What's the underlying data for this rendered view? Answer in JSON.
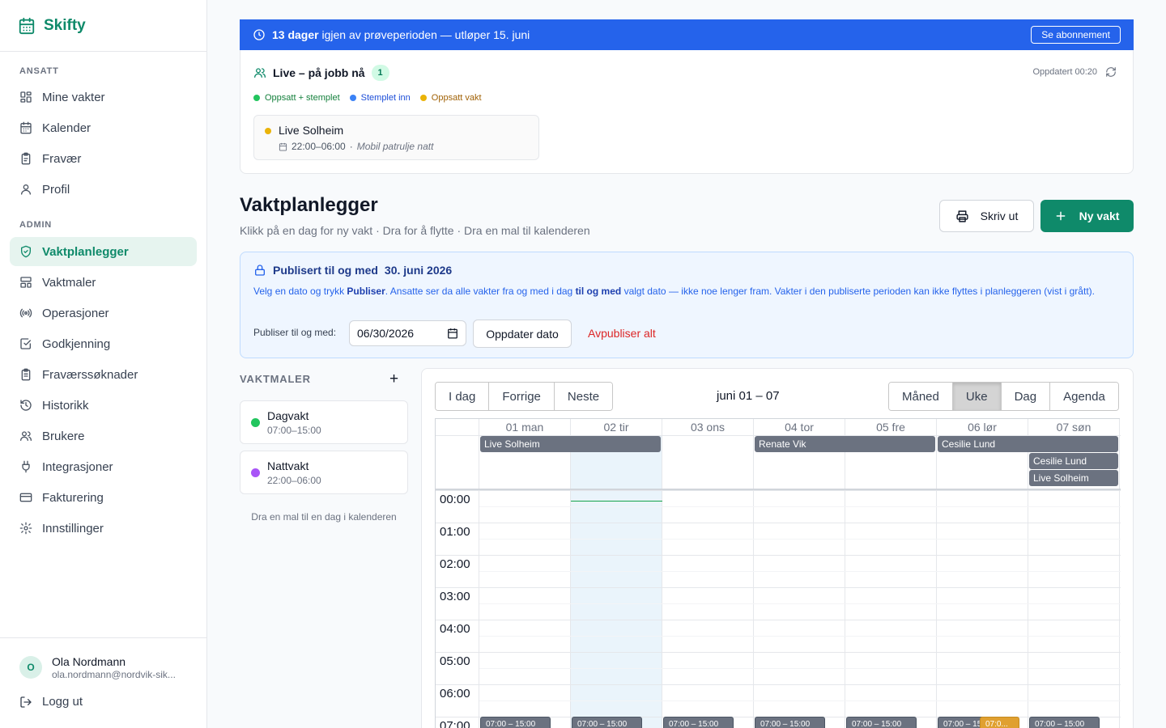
{
  "brand": {
    "name": "Skifty"
  },
  "sidebar": {
    "section_employee": "ANSATT",
    "section_admin": "ADMIN",
    "employee_items": [
      {
        "label": "Mine vakter",
        "icon": "dashboard-icon"
      },
      {
        "label": "Kalender",
        "icon": "calendar-icon"
      },
      {
        "label": "Fravær",
        "icon": "clipboard-icon"
      },
      {
        "label": "Profil",
        "icon": "user-icon"
      }
    ],
    "admin_items": [
      {
        "label": "Vaktplanlegger",
        "icon": "shield-icon",
        "active": true
      },
      {
        "label": "Vaktmaler",
        "icon": "template-icon"
      },
      {
        "label": "Operasjoner",
        "icon": "radio-icon"
      },
      {
        "label": "Godkjenning",
        "icon": "check-square-icon"
      },
      {
        "label": "Fraværssøknader",
        "icon": "clipboard-list-icon"
      },
      {
        "label": "Historikk",
        "icon": "history-icon"
      },
      {
        "label": "Brukere",
        "icon": "users-icon"
      },
      {
        "label": "Integrasjoner",
        "icon": "plug-icon"
      },
      {
        "label": "Fakturering",
        "icon": "credit-card-icon"
      },
      {
        "label": "Innstillinger",
        "icon": "gear-icon"
      }
    ],
    "user": {
      "initial": "O",
      "name": "Ola Nordmann",
      "email": "ola.nordmann@nordvik-sik..."
    },
    "logout": "Logg ut"
  },
  "trial": {
    "days": "13 dager",
    "text": "igjen av prøveperioden — utløper 15. juni",
    "button": "Se abonnement"
  },
  "live": {
    "title": "Live – på jobb nå",
    "count": "1",
    "updated": "Oppdatert 00:20",
    "legend": [
      {
        "label": "Oppsatt + stemplet",
        "color": "#22c55e",
        "text_color": "#15803d"
      },
      {
        "label": "Stemplet inn",
        "color": "#3b82f6",
        "text_color": "#1d4ed8"
      },
      {
        "label": "Oppsatt vakt",
        "color": "#eab308",
        "text_color": "#a16207"
      }
    ],
    "person": {
      "name": "Live Solheim",
      "time": "22:00–06:00",
      "separator": "·",
      "location": "Mobil patrulje natt"
    }
  },
  "page": {
    "title": "Vaktplanlegger",
    "subtitle": "Klikk på en dag for ny vakt · Dra for å flytte · Dra en mal til kalenderen",
    "print_label": "Skriv ut",
    "new_label": "Ny vakt"
  },
  "publish": {
    "title_prefix": "Publisert til og med",
    "title_date": "30. juni 2026",
    "desc_1": "Velg en dato og trykk ",
    "desc_b1": "Publiser",
    "desc_2": ". Ansatte ser da alle vakter fra og med i dag ",
    "desc_b2": "til og med",
    "desc_3": " valgt dato — ikke noe lenger fram. Vakter i den publiserte perioden kan ikke flyttes i planleggeren (vist i grått).",
    "label": "Publiser til og med:",
    "date_value": "06/30/2026",
    "update_button": "Oppdater dato",
    "unpublish": "Avpubliser alt"
  },
  "templates": {
    "heading": "VAKTMALER",
    "add": "+",
    "items": [
      {
        "name": "Dagvakt",
        "time": "07:00–15:00",
        "color": "#22c55e"
      },
      {
        "name": "Nattvakt",
        "time": "22:00–06:00",
        "color": "#a855f7"
      }
    ],
    "hint": "Dra en mal til en dag i kalenderen"
  },
  "calendar": {
    "nav": [
      "I dag",
      "Forrige",
      "Neste"
    ],
    "range": "juni 01 – 07",
    "views": [
      "Måned",
      "Uke",
      "Dag",
      "Agenda"
    ],
    "active_view": "Uke",
    "days": [
      "01 man",
      "02 tir",
      "03 ons",
      "04 tor",
      "05 fre",
      "06 lør",
      "07 søn"
    ],
    "today_index": 1,
    "hours": [
      "00:00",
      "01:00",
      "02:00",
      "03:00",
      "04:00",
      "05:00",
      "06:00",
      "07:00"
    ],
    "allday_events": [
      {
        "name": "Live Solheim",
        "start": 0,
        "span": 2,
        "row": 0
      },
      {
        "name": "Renate Vik",
        "start": 3,
        "span": 2,
        "row": 0
      },
      {
        "name": "Cesilie Lund",
        "start": 5,
        "span": 2,
        "row": 0
      },
      {
        "name": "Cesilie Lund",
        "start": 6,
        "span": 1,
        "row": 1
      },
      {
        "name": "Live Solheim",
        "start": 6,
        "span": 1,
        "row": 2
      }
    ],
    "shift_label": "07:00 – 15:00",
    "shift_label_short": "07:00 – 15",
    "overlap_label": "07:0..."
  }
}
